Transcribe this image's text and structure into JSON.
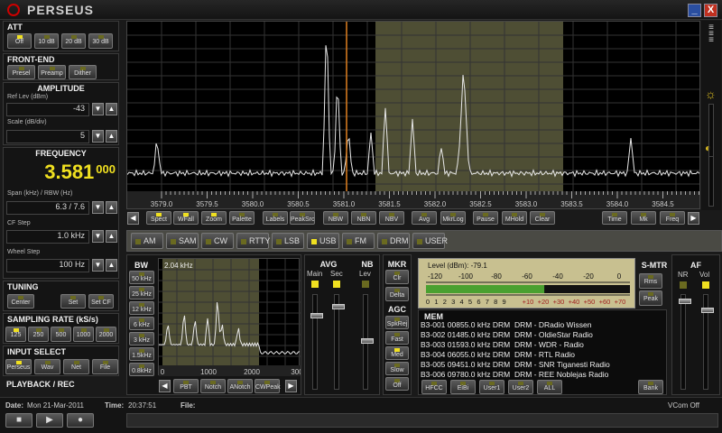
{
  "window": {
    "title": "PERSEUS",
    "minimize": "_",
    "close": "X"
  },
  "att": {
    "title": "ATT",
    "buttons": [
      {
        "label": "Off",
        "on": true
      },
      {
        "label": "10 dB",
        "on": false
      },
      {
        "label": "20 dB",
        "on": false
      },
      {
        "label": "30 dB",
        "on": false
      }
    ]
  },
  "frontend": {
    "title": "FRONT-END",
    "buttons": [
      {
        "label": "Presel",
        "on": false
      },
      {
        "label": "Preamp",
        "on": false
      },
      {
        "label": "Dither",
        "on": false
      }
    ]
  },
  "amplitude": {
    "title": "AMPLITUDE",
    "ref_label": "Ref Lev (dBm)",
    "ref_value": "-43",
    "scale_label": "Scale (dB/div)",
    "scale_value": "5"
  },
  "frequency": {
    "title": "FREQUENCY",
    "main": "3.581",
    "sub": "000",
    "span_label": "Span (kHz) / RBW (Hz)",
    "span_value": "6.3 / 7.6",
    "cfstep_label": "CF Step",
    "cfstep_value": "1.0 kHz",
    "wheel_label": "Wheel Step",
    "wheel_value": "100 Hz"
  },
  "tuning": {
    "title": "TUNING",
    "buttons": [
      "Center",
      "Set",
      "Set CF"
    ]
  },
  "sampling": {
    "title": "SAMPLING RATE (kS/s)",
    "buttons": [
      {
        "label": "125",
        "on": true
      },
      {
        "label": "250",
        "on": false
      },
      {
        "label": "500",
        "on": false
      },
      {
        "label": "1000",
        "on": false
      },
      {
        "label": "2000",
        "on": false
      }
    ]
  },
  "input": {
    "title": "INPUT SELECT",
    "buttons": [
      {
        "label": "Perseus",
        "on": true
      },
      {
        "label": "Wav",
        "on": false
      },
      {
        "label": "Net",
        "on": false
      },
      {
        "label": "File",
        "on": false
      }
    ]
  },
  "playback": {
    "title": "PLAYBACK / REC"
  },
  "status": {
    "date_label": "Date:",
    "date": "Mon 21-Mar-2011",
    "time_label": "Time:",
    "time": "20:37:51",
    "file_label": "File:",
    "vcom": "VCom Off"
  },
  "spectrum": {
    "x_ticks": [
      "3579.0",
      "3579.5",
      "3580.0",
      "3580.5",
      "3581.0",
      "3581.5",
      "3582.0",
      "3582.5",
      "3583.0",
      "3583.5",
      "3584.0",
      "3584.5"
    ],
    "toolbar": [
      {
        "label": "Spect",
        "on": true
      },
      {
        "label": "WFall",
        "on": true
      },
      {
        "label": "Zoom",
        "on": true
      },
      {
        "label": "Palette",
        "on": false
      },
      {
        "label": "Labels",
        "on": false
      },
      {
        "label": "PeakSrc",
        "on": false
      },
      {
        "label": "NBW",
        "on": false
      },
      {
        "label": "NBN",
        "on": false
      },
      {
        "label": "NBV",
        "on": false
      },
      {
        "label": "Avg",
        "on": false
      },
      {
        "label": "MkrLog",
        "on": false
      },
      {
        "label": "Pause",
        "on": false
      },
      {
        "label": "MHold",
        "on": false
      },
      {
        "label": "Clear",
        "on": false
      },
      {
        "label": "Time",
        "on": false
      },
      {
        "label": "Mk",
        "on": false
      },
      {
        "label": "Freq",
        "on": false
      }
    ]
  },
  "demod": {
    "modes": [
      {
        "label": "AM",
        "on": false
      },
      {
        "label": "SAM",
        "on": false
      },
      {
        "label": "CW",
        "on": false
      },
      {
        "label": "RTTY",
        "on": false
      },
      {
        "label": "LSB",
        "on": false
      },
      {
        "label": "USB",
        "on": true
      },
      {
        "label": "FM",
        "on": false
      },
      {
        "label": "DRM",
        "on": false
      },
      {
        "label": "USER",
        "on": false
      }
    ]
  },
  "bw": {
    "title": "BW",
    "buttons": [
      "50 kHz",
      "25 kHz",
      "12 kHz",
      "6 kHz",
      "3 kHz",
      "1.5kHz",
      "0.8kHz"
    ],
    "filter_label": "2.04 kHz",
    "ticks": [
      "0",
      "1000",
      "2000",
      "300"
    ],
    "toolbar": [
      "PBT",
      "Notch",
      "ANotch",
      "CWPeak"
    ]
  },
  "avg": {
    "title": "AVG",
    "main": "Main",
    "sec": "Sec"
  },
  "nb": {
    "title": "NB",
    "lev": "Lev"
  },
  "mkr": {
    "title": "MKR",
    "clr": "Clr",
    "delta": "Delta"
  },
  "agc": {
    "title": "AGC",
    "buttons": [
      "SpkRej",
      "Fast",
      "Med",
      "Slow",
      "Off"
    ]
  },
  "smeter": {
    "level_label": "Level (dBm):",
    "level_value": "-79.1",
    "top_scale": [
      "-120",
      "-100",
      "-80",
      "-60",
      "-40",
      "-20",
      "0"
    ],
    "bottom_scale": [
      "0",
      "1",
      "2",
      "3",
      "4",
      "5",
      "6",
      "7",
      "8",
      "9",
      "+10",
      "+20",
      "+30",
      "+40",
      "+50",
      "+60",
      "+70"
    ],
    "level_fraction": 0.58,
    "title": "S-MTR",
    "rms": "Rms",
    "peak": "Peak"
  },
  "memory": {
    "title": "MEM",
    "rows": [
      "B3-001 00855.0 kHz DRM  DRM - DRadio Wissen",
      "B3-002 01485.0 kHz DRM  DRM - OldieStar Radio",
      "B3-003 01593.0 kHz DRM  DRM - WDR - Radio",
      "B3-004 06055.0 kHz DRM  DRM - RTL Radio",
      "B3-005 09451.0 kHz DRM  DRM - SNR Tiganesti Radio",
      "B3-006 09780.0 kHz DRM  DRM - REE Noblejas Radio"
    ],
    "buttons": [
      "HFCC",
      "EiBi",
      "User1",
      "User2",
      "ALL"
    ],
    "bank": "Bank"
  },
  "af": {
    "title": "AF",
    "nr": "NR",
    "vol": "Vol"
  },
  "colors": {
    "accent": "#f0e020",
    "passband": "#4e4e34",
    "cursor": "#e08020"
  }
}
